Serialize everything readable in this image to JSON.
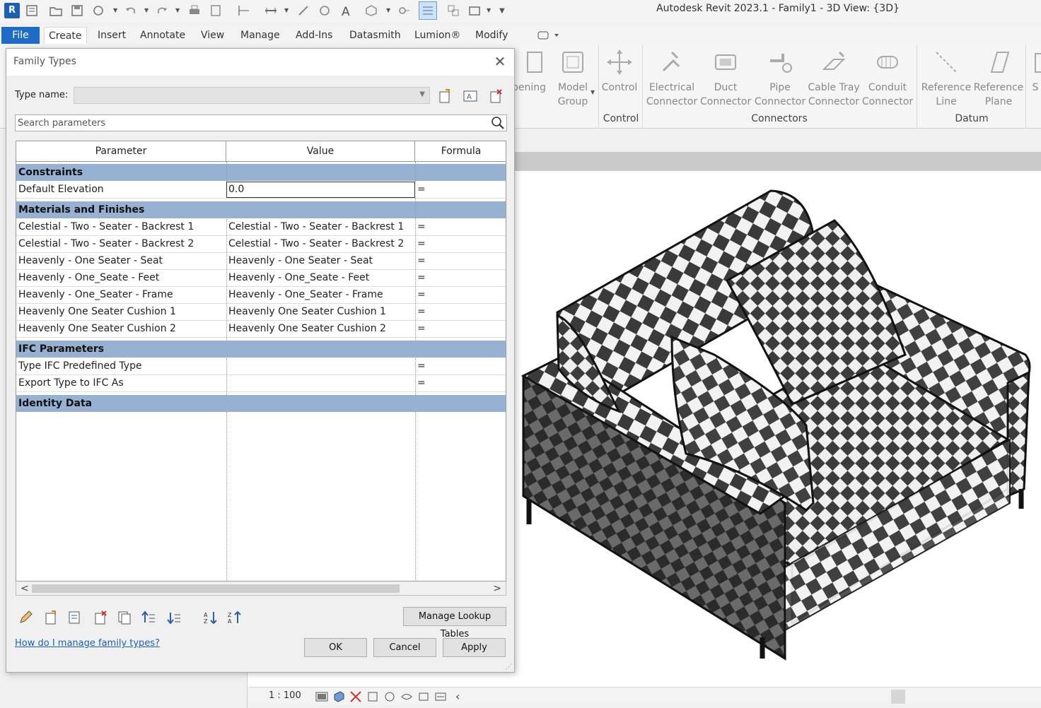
{
  "app": {
    "logo_letter": "R",
    "title": "Autodesk Revit 2023.1 - Family1 - 3D View: {3D}"
  },
  "quick_access": {
    "icons": [
      "new-icon",
      "open-icon",
      "save-icon",
      "sync-icon",
      "undo-icon",
      "redo-icon",
      "print-icon",
      "measure-icon",
      "aligned-dimension-icon",
      "tag-icon",
      "text-icon",
      "3d-view-icon",
      "section-icon",
      "thin-lines-icon",
      "close-windows-icon",
      "switch-windows-icon",
      "customize-icon"
    ]
  },
  "ribbon": {
    "tabs": [
      {
        "label": "File"
      },
      {
        "label": "Create"
      },
      {
        "label": "Insert"
      },
      {
        "label": "Annotate"
      },
      {
        "label": "View"
      },
      {
        "label": "Manage"
      },
      {
        "label": "Add-Ins"
      },
      {
        "label": "Datasmith"
      },
      {
        "label": "Lumion®"
      },
      {
        "label": "Modify"
      }
    ],
    "buttons": {
      "opening": "pening",
      "model_group_1": "Model",
      "model_group_2": "Group",
      "control": "Control",
      "electrical_1": "Electrical",
      "electrical_2": "Connector",
      "duct_1": "Duct",
      "duct_2": "Connector",
      "pipe_1": "Pipe",
      "pipe_2": "Connector",
      "cable_1": "Cable Tray",
      "cable_2": "Connector",
      "conduit_1": "Conduit",
      "conduit_2": "Connector",
      "refline_1": "Reference",
      "refline_2": "Line",
      "refplane_1": "Reference",
      "refplane_2": "Plane",
      "trailing": "S"
    },
    "groups": {
      "control": "Control",
      "connectors": "Connectors",
      "datum": "Datum"
    }
  },
  "dialog": {
    "title": "Family Types",
    "type_name_label": "Type name:",
    "type_name_value": "",
    "search_placeholder": "Search parameters",
    "columns": {
      "parameter": "Parameter",
      "value": "Value",
      "formula": "Formula"
    },
    "groups": {
      "constraints": "Constraints",
      "materials": "Materials and Finishes",
      "ifc": "IFC Parameters",
      "identity": "Identity Data"
    },
    "rows": {
      "default_elevation": {
        "param": "Default Elevation",
        "value": "0.0",
        "formula": "="
      },
      "mat": [
        {
          "param": "Celestial - Two - Seater - Backrest 1",
          "value": "Celestial - Two - Seater - Backrest 1",
          "formula": "="
        },
        {
          "param": "Celestial - Two - Seater - Backrest 2",
          "value": "Celestial - Two - Seater - Backrest 2",
          "formula": "="
        },
        {
          "param": "Heavenly - One Seater - Seat",
          "value": "Heavenly - One Seater - Seat",
          "formula": "="
        },
        {
          "param": "Heavenly - One_Seate - Feet",
          "value": "Heavenly - One_Seate - Feet",
          "formula": "="
        },
        {
          "param": "Heavenly - One_Seater - Frame",
          "value": "Heavenly - One_Seater - Frame",
          "formula": "="
        },
        {
          "param": "Heavenly One Seater Cushion 1",
          "value": "Heavenly One Seater Cushion 1",
          "formula": "="
        },
        {
          "param": "Heavenly One Seater Cushion 2",
          "value": "Heavenly One Seater Cushion 2",
          "formula": "="
        }
      ],
      "ifc": [
        {
          "param": "Type IFC Predefined Type",
          "value": "",
          "formula": "="
        },
        {
          "param": "Export Type to IFC As",
          "value": "",
          "formula": "="
        }
      ]
    },
    "toolbar_icons": [
      "edit-pencil-icon",
      "new-parameter-icon",
      "parameter-properties-icon",
      "delete-parameter-icon",
      "copy-parameter-icon",
      "move-up-icon",
      "move-down-icon",
      "sort-ascending-icon",
      "sort-descending-icon"
    ],
    "manage_lookup_label": "Manage Lookup Tables",
    "help_link": "How do I manage family types?",
    "ok_label": "OK",
    "cancel_label": "Cancel",
    "apply_label": "Apply"
  },
  "statusbar": {
    "scale": "1 : 100"
  },
  "colors": {
    "group_header": "#97b1d2",
    "file_tab": "#1e6cc8",
    "link": "#1b5fb5"
  }
}
